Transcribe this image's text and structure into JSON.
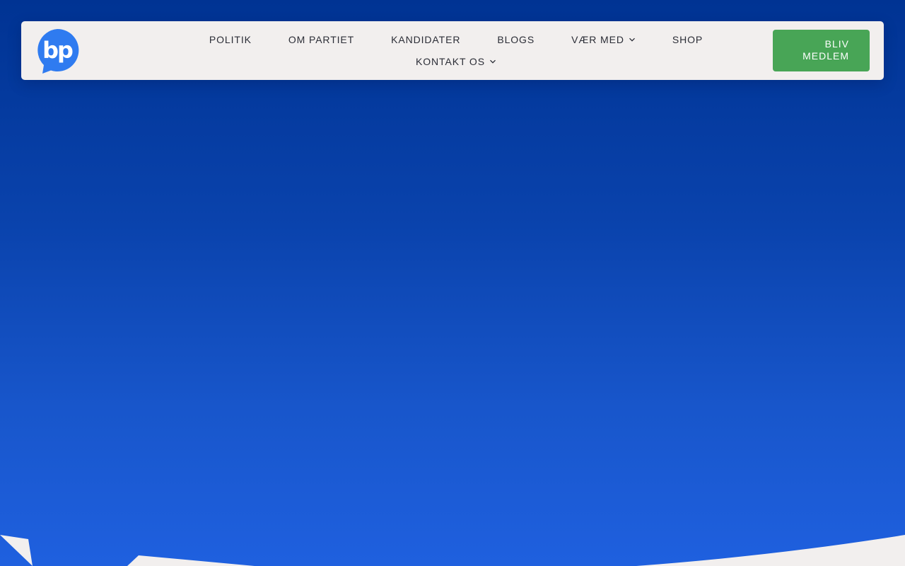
{
  "colors": {
    "hero_top": "#003393",
    "hero_bottom": "#1f60df",
    "navbar_bg": "#f2efee",
    "nav_text": "#2b2d36",
    "cta_bg": "#48a556",
    "logo_blue": "#2f7bf0"
  },
  "logo": {
    "text": "bp",
    "icon": "speech-bubble-logo"
  },
  "nav": {
    "items": [
      {
        "label": "POLITIK"
      },
      {
        "label": "OM PARTIET"
      },
      {
        "label": "KANDIDATER"
      },
      {
        "label": "BLOGS"
      },
      {
        "label": "VÆR MED",
        "has_dropdown": true,
        "icon": "chevron-down-icon"
      },
      {
        "label": "SHOP"
      },
      {
        "label": "KONTAKT OS",
        "has_dropdown": true,
        "icon": "chevron-down-icon"
      }
    ]
  },
  "cta": {
    "line1": "BLIV",
    "line2": "MEDLEM"
  }
}
